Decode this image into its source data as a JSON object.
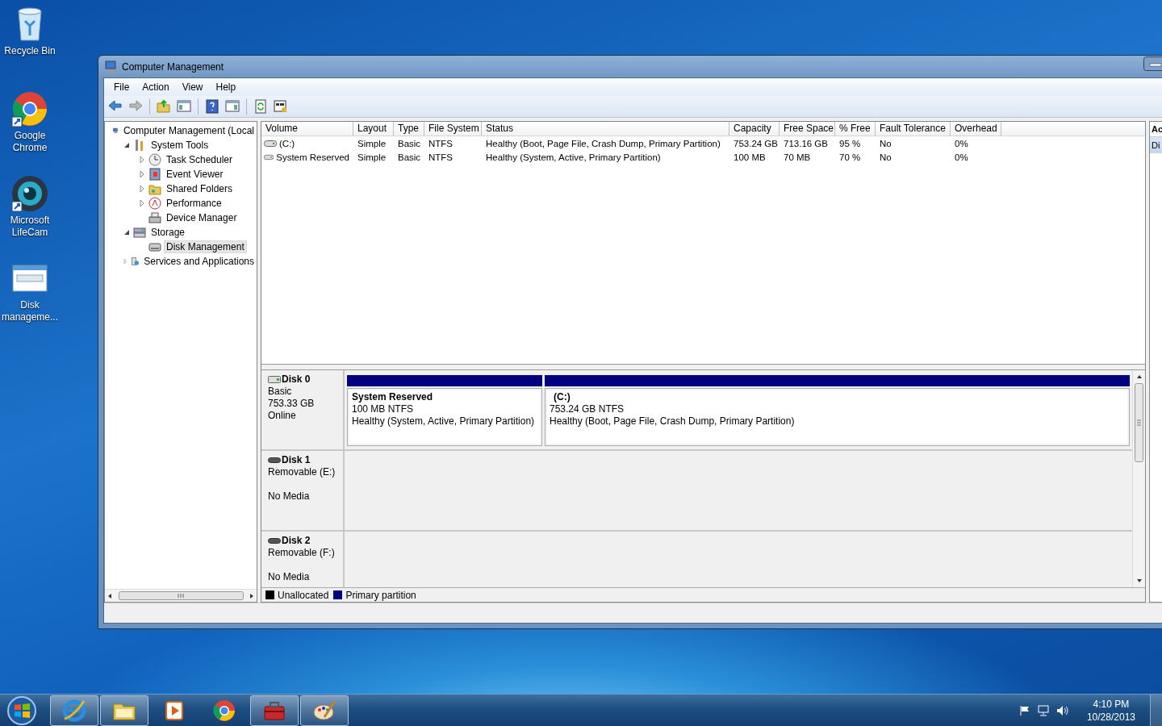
{
  "desktop_icons": [
    {
      "label": "Recycle Bin"
    },
    {
      "label": "Google Chrome"
    },
    {
      "label": "Microsoft LifeCam"
    },
    {
      "label": "Disk manageme..."
    }
  ],
  "window": {
    "title": "Computer Management",
    "menu": [
      "File",
      "Action",
      "View",
      "Help"
    ],
    "tree": [
      {
        "label": "Computer Management (Local",
        "selected": false,
        "children": [
          {
            "label": "System Tools",
            "selected": false,
            "expanded": true,
            "children": [
              {
                "label": "Task Scheduler",
                "selected": false,
                "expanded": false
              },
              {
                "label": "Event Viewer",
                "selected": false,
                "expanded": false
              },
              {
                "label": "Shared Folders",
                "selected": false,
                "expanded": false
              },
              {
                "label": "Performance",
                "selected": false,
                "expanded": false
              },
              {
                "label": "Device Manager",
                "selected": false
              }
            ]
          },
          {
            "label": "Storage",
            "selected": false,
            "expanded": true,
            "children": [
              {
                "label": "Disk Management",
                "selected": true
              }
            ]
          },
          {
            "label": "Services and Applications",
            "selected": false,
            "expanded": false
          }
        ]
      }
    ],
    "volumes": {
      "columns": [
        "Volume",
        "Layout",
        "Type",
        "File System",
        "Status",
        "Capacity",
        "Free Space",
        "% Free",
        "Fault Tolerance",
        "Overhead"
      ],
      "rows": [
        {
          "cells": [
            "(C:)",
            "Simple",
            "Basic",
            "NTFS",
            "Healthy (Boot, Page File, Crash Dump, Primary Partition)",
            "753.24 GB",
            "713.16 GB",
            "95 %",
            "No",
            "0%"
          ]
        },
        {
          "cells": [
            "System Reserved",
            "Simple",
            "Basic",
            "NTFS",
            "Healthy (System, Active, Primary Partition)",
            "100 MB",
            "70 MB",
            "70 %",
            "No",
            "0%"
          ]
        }
      ]
    },
    "disks": [
      {
        "name": "Disk 0",
        "kind": "basic",
        "type": "Basic",
        "size": "753.33 GB",
        "state": "Online",
        "partitions": [
          {
            "name": "System Reserved",
            "size": "100 MB NTFS",
            "status": "Healthy (System, Active, Primary Partition)",
            "color": "#000080"
          },
          {
            "name": "(C:)",
            "size": "753.24 GB NTFS",
            "status": "Healthy (Boot, Page File, Crash Dump, Primary Partition)",
            "color": "#000080"
          }
        ]
      },
      {
        "name": "Disk 1",
        "kind": "removable",
        "type": "Removable (E:)",
        "state": "No Media"
      },
      {
        "name": "Disk 2",
        "kind": "removable",
        "type": "Removable (F:)",
        "state": "No Media"
      }
    ],
    "legend": [
      {
        "label": "Unallocated",
        "color": "#000000"
      },
      {
        "label": "Primary partition",
        "color": "#000080"
      }
    ],
    "action_pane": {
      "title": "Ac",
      "items": [
        {
          "label": "Di",
          "selected": true
        }
      ]
    }
  },
  "taskbar": {
    "apps": [
      {
        "running": true
      },
      {
        "running": true
      },
      {
        "running": false
      },
      {
        "running": false
      },
      {
        "running": true
      },
      {
        "running": true
      }
    ],
    "clock": {
      "time": "4:10 PM",
      "date": "10/28/2013"
    }
  }
}
